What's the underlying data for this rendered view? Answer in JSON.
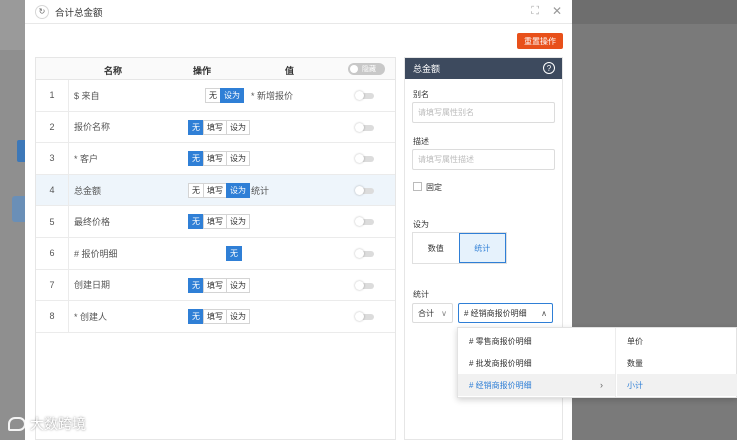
{
  "dialog": {
    "title": "合计总金额",
    "refresh_icon": "↻",
    "expand_icon": "⛶",
    "close_icon": "✕"
  },
  "reset_button": "重置操作",
  "table": {
    "headers": {
      "name": "名称",
      "action": "操作",
      "value": "值"
    },
    "header_toggle": "隐藏",
    "rows": [
      {
        "num": "1",
        "name": "$ 来自",
        "options": [
          "无",
          "设为"
        ],
        "active": "设为",
        "value": "* 新增报价"
      },
      {
        "num": "2",
        "name": "报价名称",
        "options": [
          "无",
          "填写",
          "设为"
        ],
        "active": "无",
        "value": ""
      },
      {
        "num": "3",
        "name": "* 客户",
        "options": [
          "无",
          "填写",
          "设为"
        ],
        "active": "无",
        "value": ""
      },
      {
        "num": "4",
        "name": "总金额",
        "options": [
          "无",
          "填写",
          "设为"
        ],
        "active": "设为",
        "value": "统计"
      },
      {
        "num": "5",
        "name": "最终价格",
        "options": [
          "无",
          "填写",
          "设为"
        ],
        "active": "无",
        "value": ""
      },
      {
        "num": "6",
        "name": "# 报价明细",
        "options": [
          "无"
        ],
        "active": "无",
        "value": ""
      },
      {
        "num": "7",
        "name": "创建日期",
        "options": [
          "无",
          "填写",
          "设为"
        ],
        "active": "无",
        "value": ""
      },
      {
        "num": "8",
        "name": "* 创建人",
        "options": [
          "无",
          "填写",
          "设为"
        ],
        "active": "无",
        "value": ""
      }
    ]
  },
  "panel": {
    "title": "总金额",
    "help_icon": "?",
    "alias_label": "别名",
    "alias_placeholder": "请填写属性别名",
    "desc_label": "描述",
    "desc_placeholder": "请填写属性描述",
    "fixed_label": "固定",
    "setas_label": "设为",
    "setas_options": [
      "数值",
      "统计"
    ],
    "setas_active": "统计",
    "stat_label": "统计",
    "stat_func": "合计",
    "stat_field": "# 经销商报价明细",
    "chevron_down": "∨",
    "chevron_up": "∧"
  },
  "dropdown": {
    "col1": [
      "# 零售商报价明细",
      "# 批发商报价明细",
      "# 经销商报价明细"
    ],
    "col1_active": 2,
    "col2": [
      "单价",
      "数量",
      "小计"
    ],
    "col2_active": 2,
    "chevron": "›"
  },
  "watermark": "大数跨境",
  "colors": {
    "accent": "#2f7fd6",
    "reset": "#e8501a",
    "panel_header": "#3d4a5e"
  }
}
